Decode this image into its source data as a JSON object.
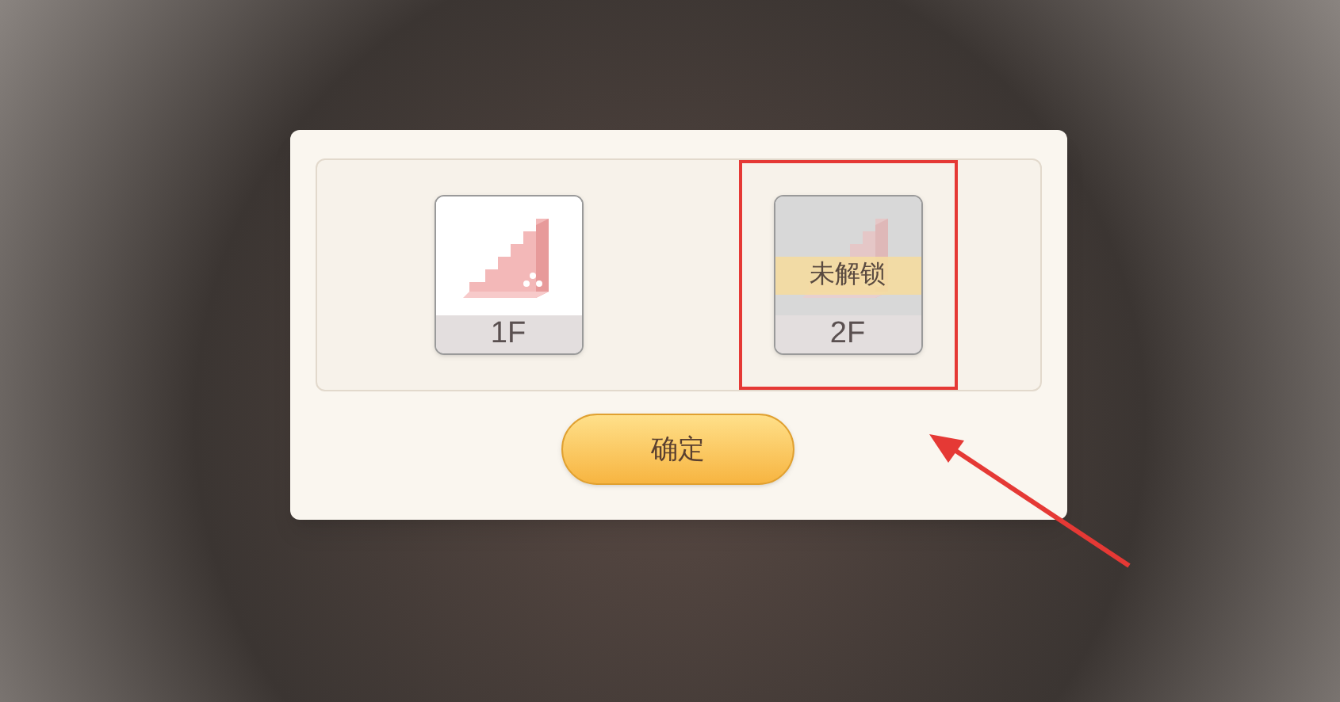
{
  "floors": [
    {
      "label": "1F",
      "locked": false,
      "highlighted": false
    },
    {
      "label": "2F",
      "locked": true,
      "lock_label": "未解锁",
      "highlighted": true
    }
  ],
  "confirm_button": "确定"
}
